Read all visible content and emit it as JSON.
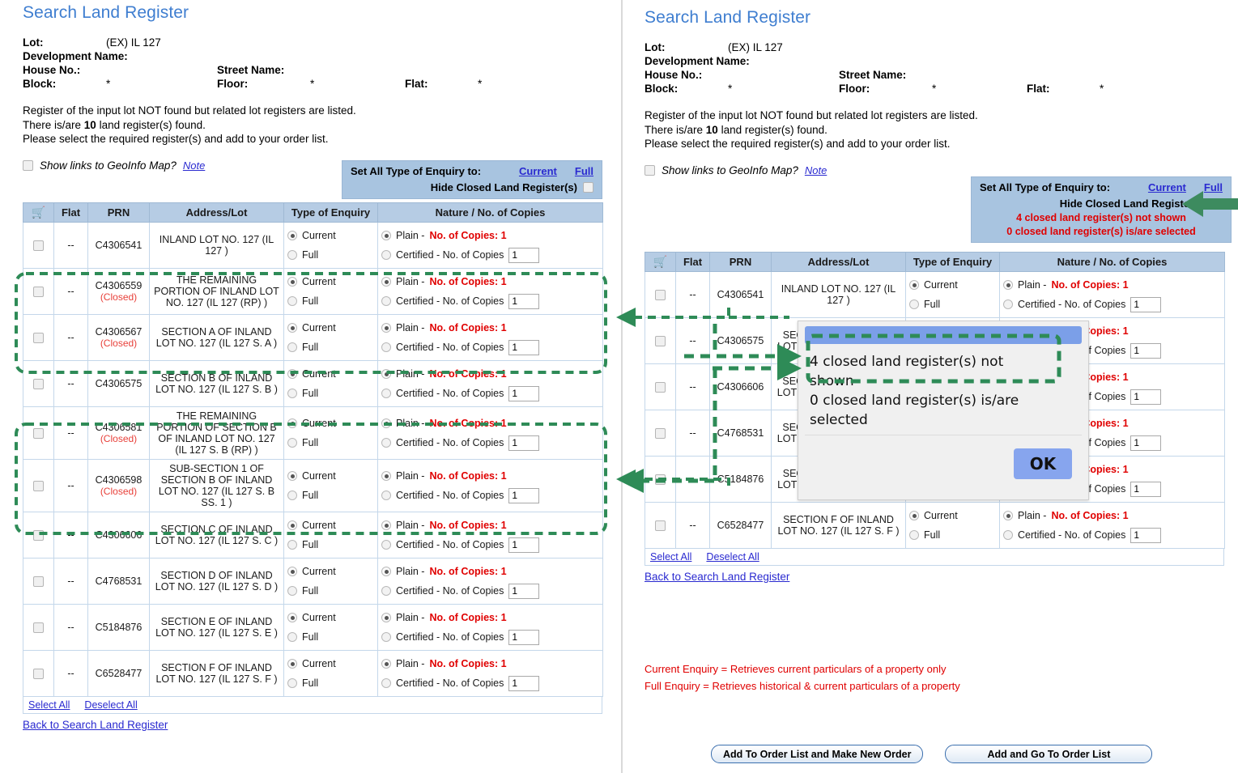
{
  "page": {
    "title": "Search Land Register",
    "accent_blue": "#3f7ed0",
    "header_blue": "#b6cce4",
    "box_blue": "#a8c4e0",
    "red": "#e00000",
    "annotation_green": "#2e8b57"
  },
  "lot_info": {
    "lot_label": "Lot:",
    "lot_value": "(EX) IL 127",
    "development_label": "Development Name:",
    "development_value": "",
    "house_no_label": "House No.:",
    "house_no_value": "",
    "street_label": "Street Name:",
    "street_value": "",
    "block_label": "Block:",
    "block_value": "*",
    "floor_label": "Floor:",
    "floor_value": "*",
    "flat_label": "Flat:",
    "flat_value": "*"
  },
  "messages": {
    "line1": "Register of the input lot NOT found but related lot registers are listed.",
    "line2_pre": "There is/are ",
    "line2_count": "10",
    "line2_post": " land register(s) found.",
    "line3": "Please select the required register(s) and add to your order list."
  },
  "geoinfo": {
    "label": "Show links to GeoInfo Map?",
    "note_link": "Note",
    "checked": false
  },
  "set_all": {
    "label": "Set All Type of Enquiry to:",
    "current_link": "Current",
    "full_link": "Full",
    "hide_closed_label": "Hide Closed Land Register(s)",
    "hide_closed_checked_left": false,
    "hide_closed_checked_right": true,
    "not_shown_text": "4 closed land register(s) not shown",
    "selected_text": "0 closed land register(s) is/are selected"
  },
  "table": {
    "headers": {
      "cart": "cart-icon",
      "flat": "Flat",
      "prn": "PRN",
      "address": "Address/Lot",
      "type": "Type of Enquiry",
      "nature": "Nature / No. of Copies"
    },
    "options": {
      "current": "Current",
      "full": "Full",
      "plain_prefix": "Plain - ",
      "plain_copies": "No. of Copies: 1",
      "certified": "Certified - No. of Copies",
      "certified_value": "1"
    },
    "closed_tag": "(Closed)",
    "flat_value": "--",
    "select_all": "Select All",
    "deselect_all": "Deselect All",
    "back_link": "Back to Search Land Register"
  },
  "rows_left": [
    {
      "prn": "C4306541",
      "closed": false,
      "address": "INLAND LOT NO. 127 (IL 127 )"
    },
    {
      "prn": "C4306559",
      "closed": true,
      "address": "THE REMAINING PORTION OF INLAND LOT NO. 127 (IL 127 (RP) )"
    },
    {
      "prn": "C4306567",
      "closed": true,
      "address": "SECTION A OF INLAND LOT NO. 127 (IL 127 S. A )"
    },
    {
      "prn": "C4306575",
      "closed": false,
      "address": "SECTION B OF INLAND LOT NO. 127 (IL 127 S. B )"
    },
    {
      "prn": "C4306581",
      "closed": true,
      "address": "THE REMAINING PORTION OF SECTION B OF INLAND LOT NO. 127 (IL 127 S. B (RP) )"
    },
    {
      "prn": "C4306598",
      "closed": true,
      "address": "SUB-SECTION 1 OF SECTION B OF INLAND LOT NO. 127 (IL 127 S. B SS. 1 )"
    },
    {
      "prn": "C4306606",
      "closed": false,
      "address": "SECTION C OF INLAND LOT NO. 127 (IL 127 S. C )"
    },
    {
      "prn": "C4768531",
      "closed": false,
      "address": "SECTION D OF INLAND LOT NO. 127 (IL 127 S. D )"
    },
    {
      "prn": "C5184876",
      "closed": false,
      "address": "SECTION E OF INLAND LOT NO. 127 (IL 127 S. E )"
    },
    {
      "prn": "C6528477",
      "closed": false,
      "address": "SECTION F OF INLAND LOT NO. 127 (IL 127 S. F )"
    }
  ],
  "rows_right": [
    {
      "prn": "C4306541",
      "closed": false,
      "address": "INLAND LOT NO. 127 (IL 127 )"
    },
    {
      "prn": "C4306575",
      "closed": false,
      "address": "SECTION B OF INLAND LOT NO. 127 (IL 127 S. B )"
    },
    {
      "prn": "C4306606",
      "closed": false,
      "address": "SECTION C OF INLAND LOT NO. 127 (IL 127 S. C )"
    },
    {
      "prn": "C4768531",
      "closed": false,
      "address": "SECTION D OF INLAND LOT NO. 127 (IL 127 S. D )"
    },
    {
      "prn": "C5184876",
      "closed": false,
      "address": "SECTION E OF INLAND LOT NO. 127 (IL 127 S. E )"
    },
    {
      "prn": "C6528477",
      "closed": false,
      "address": "SECTION F OF INLAND LOT NO. 127 (IL 127 S. F )"
    }
  ],
  "dialog": {
    "message_line1": "4 closed land register(s) not",
    "message_line2": "shown",
    "message_line3": "0 closed land register(s) is/are",
    "message_line4": "selected",
    "ok_label": "OK"
  },
  "legend": {
    "line1": "Current Enquiry = Retrieves current particulars of a property only",
    "line2": "Full Enquiry = Retrieves historical & current particulars of a property"
  },
  "buttons": {
    "add_new_order": "Add To Order List and Make New Order",
    "add_go_order": "Add and Go To Order List"
  }
}
